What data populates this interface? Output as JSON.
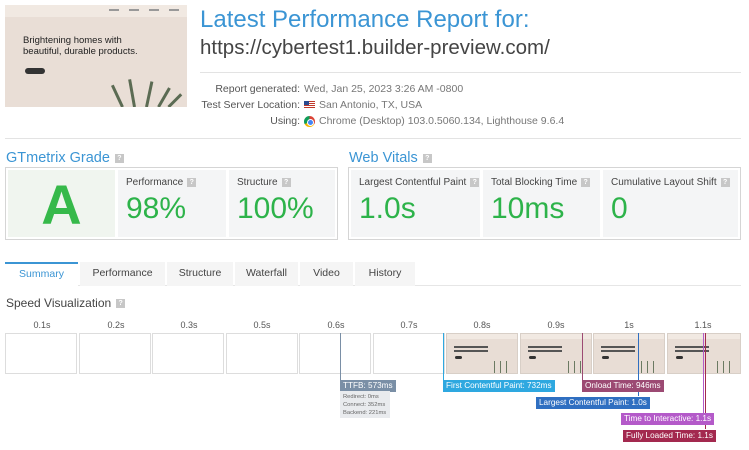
{
  "header": {
    "title": "Latest Performance Report for:",
    "url": "https://cybertest1.builder-preview.com/",
    "thumbnail_heading": "Brightening homes with beautiful, durable products."
  },
  "meta": [
    {
      "label": "Report generated:",
      "value": "Wed, Jan 25, 2023 3:26 AM -0800",
      "icon": ""
    },
    {
      "label": "Test Server Location:",
      "value": "San Antonio, TX, USA",
      "icon": "us-flag-icon"
    },
    {
      "label": "Using:",
      "value": "Chrome (Desktop) 103.0.5060.134, Lighthouse 9.6.4",
      "icon": "chrome-icon"
    }
  ],
  "grade": {
    "heading": "GTmetrix Grade",
    "letter": "A",
    "performance_label": "Performance",
    "performance_value": "98%",
    "structure_label": "Structure",
    "structure_value": "100%"
  },
  "vitals": {
    "heading": "Web Vitals",
    "lcp_label": "Largest Contentful Paint",
    "lcp_value": "1.0s",
    "tbt_label": "Total Blocking Time",
    "tbt_value": "10ms",
    "cls_label": "Cumulative Layout Shift",
    "cls_value": "0"
  },
  "tabs": [
    "Summary",
    "Performance",
    "Structure",
    "Waterfall",
    "Video",
    "History"
  ],
  "active_tab": "Summary",
  "speed": {
    "heading": "Speed Visualization",
    "ticks": [
      "0.1s",
      "0.2s",
      "0.3s",
      "0.5s",
      "0.6s",
      "0.7s",
      "0.8s",
      "0.9s",
      "1s",
      "1.1s"
    ],
    "ttfb": "TTFB: 573ms",
    "ttfb_redirect": "Redirect: 0ms",
    "ttfb_connect": "Connect: 352ms",
    "ttfb_backend": "Backend: 221ms",
    "fcp": "First Contentful Paint: 732ms",
    "lcp": "Largest Contentful Paint: 1.0s",
    "onload": "Onload Time: 946ms",
    "tti": "Time to Interactive: 1.1s",
    "fully_loaded": "Fully Loaded Time: 1.1s"
  },
  "colors": {
    "accent": "#3b95d4",
    "grade_green": "#36b94a",
    "ttfb": "#7a8fa6",
    "fcp": "#2ea8e0",
    "lcp": "#2f6fc1",
    "onload": "#9c4a73",
    "tti": "#b45ac9",
    "fully_loaded": "#a3294f"
  }
}
